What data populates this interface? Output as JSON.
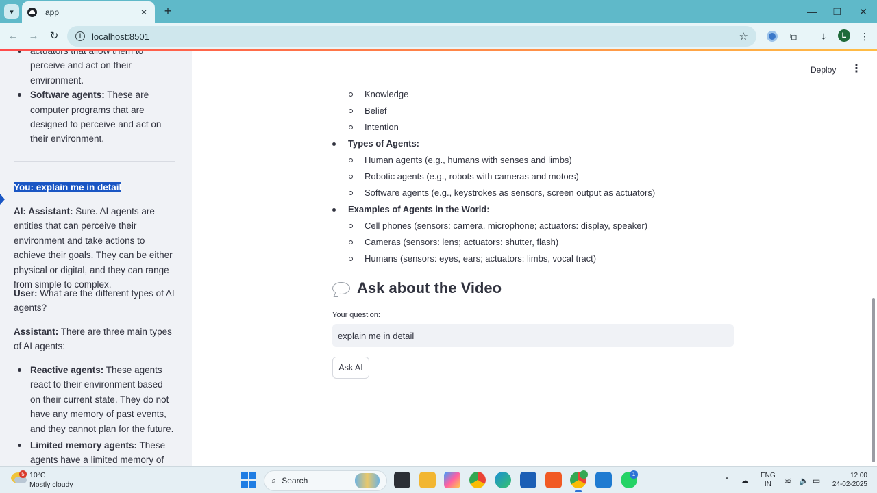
{
  "browser": {
    "tab_title": "app",
    "url": "localhost:8501",
    "profile_initial": "L"
  },
  "sidebar": {
    "top_item_tail": "actuators that allow them to perceive and act on their environment.",
    "software_agents": {
      "label": "Software agents:",
      "text": " These are computer programs that are designed to perceive and act on their environment."
    },
    "you_line": "You: explain me in detail",
    "ai_assistant": {
      "label": "AI: Assistant:",
      "text": " Sure. AI agents are entities that can perceive their environment and take actions to achieve their goals. They can be either physical or digital, and they can range from simple to complex."
    },
    "user": {
      "label": "User:",
      "text": " What are the different types of AI agents?"
    },
    "assistant": {
      "label": "Assistant:",
      "text": " There are three main types of AI agents:"
    },
    "reactive": {
      "label": "Reactive agents:",
      "text": " These agents react to their environment based on their current state. They do not have any memory of past events, and they cannot plan for the future."
    },
    "limited": {
      "label": "Limited memory agents:",
      "text": " These agents have a limited memory of past"
    }
  },
  "header": {
    "deploy_label": "Deploy",
    "menu_glyph": "⋮"
  },
  "main": {
    "sub_items_1": [
      "Knowledge",
      "Belief",
      "Intention"
    ],
    "types_heading": "Types of Agents:",
    "types_items": [
      "Human agents (e.g., humans with senses and limbs)",
      "Robotic agents (e.g., robots with cameras and motors)",
      "Software agents (e.g., keystrokes as sensors, screen output as actuators)"
    ],
    "examples_heading": "Examples of Agents in the World:",
    "examples_items": [
      "Cell phones (sensors: camera, microphone; actuators: display, speaker)",
      "Cameras (sensors: lens; actuators: shutter, flash)",
      "Humans (sensors: eyes, ears; actuators: limbs, vocal tract)"
    ],
    "section_title": "Ask about the Video",
    "question_label": "Your question:",
    "question_value": "explain me in detail",
    "ask_button": "Ask AI"
  },
  "taskbar": {
    "weather_badge": "5",
    "temperature": "10°C",
    "condition": "Mostly cloudy",
    "search_label": "Search",
    "lang_1": "ENG",
    "lang_2": "IN",
    "time": "12:00",
    "date": "24-02-2025",
    "whatsapp_badge": "1"
  },
  "icons": {
    "tab_menu": "chevron-down-icon",
    "close": "close-icon",
    "new_tab": "plus-icon",
    "back": "arrow-left-icon",
    "forward": "arrow-right-icon",
    "reload": "reload-icon",
    "bookmark": "star-icon",
    "extensions": "puzzle-icon",
    "downloads": "download-icon",
    "chat": "speech-balloon-icon"
  },
  "colors": {
    "tab_strip": "#5fb9c9",
    "sidebar_bg": "#f0f2f6",
    "selection": "#1a56c4",
    "accent_gradient_start": "#ff4b4b",
    "accent_gradient_end": "#ffbd45"
  }
}
